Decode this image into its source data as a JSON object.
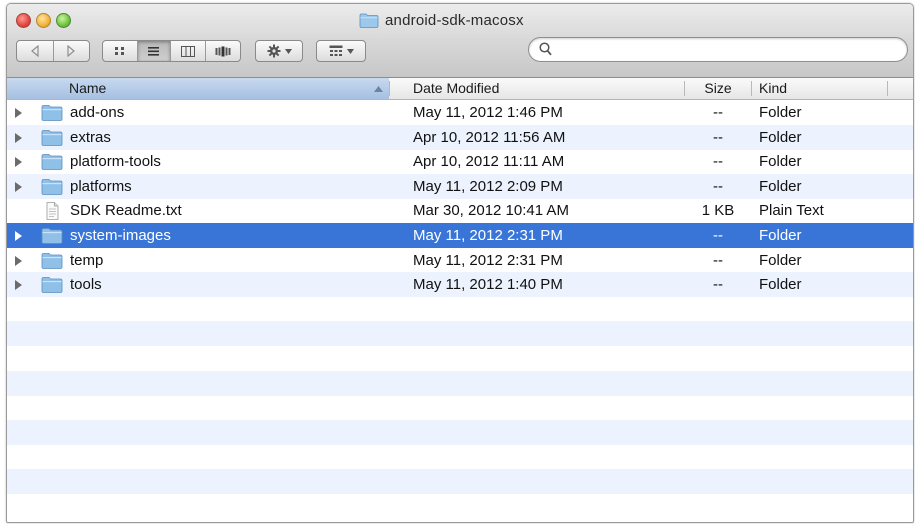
{
  "window": {
    "title": "android-sdk-macosx"
  },
  "toolbar": {
    "back_icon": "back-arrow-icon",
    "forward_icon": "forward-arrow-icon",
    "view_modes": [
      "icon-view",
      "list-view",
      "column-view",
      "cover-flow-view"
    ],
    "active_view": "list-view",
    "action_menu_icon": "gear-icon",
    "arrange_menu_icon": "arrange-icon"
  },
  "search": {
    "value": "",
    "placeholder": ""
  },
  "columns": {
    "name": "Name",
    "date": "Date Modified",
    "size": "Size",
    "kind": "Kind",
    "sort_column": "name",
    "sort_direction": "ascending"
  },
  "files": [
    {
      "name": "add-ons",
      "date": "May 11, 2012 1:46 PM",
      "size": "--",
      "kind": "Folder",
      "type": "folder"
    },
    {
      "name": "extras",
      "date": "Apr 10, 2012 11:56 AM",
      "size": "--",
      "kind": "Folder",
      "type": "folder"
    },
    {
      "name": "platform-tools",
      "date": "Apr 10, 2012 11:11 AM",
      "size": "--",
      "kind": "Folder",
      "type": "folder"
    },
    {
      "name": "platforms",
      "date": "May 11, 2012 2:09 PM",
      "size": "--",
      "kind": "Folder",
      "type": "folder"
    },
    {
      "name": "SDK Readme.txt",
      "date": "Mar 30, 2012 10:41 AM",
      "size": "1 KB",
      "kind": "Plain Text",
      "type": "file"
    },
    {
      "name": "system-images",
      "date": "May 11, 2012 2:31 PM",
      "size": "--",
      "kind": "Folder",
      "type": "folder",
      "selected": true
    },
    {
      "name": "temp",
      "date": "May 11, 2012 2:31 PM",
      "size": "--",
      "kind": "Folder",
      "type": "folder"
    },
    {
      "name": "tools",
      "date": "May 11, 2012 1:40 PM",
      "size": "--",
      "kind": "Folder",
      "type": "folder"
    }
  ],
  "colors": {
    "selection": "#3875d7",
    "stripe": "#edf3fe",
    "folder": "#8fc0e8"
  }
}
